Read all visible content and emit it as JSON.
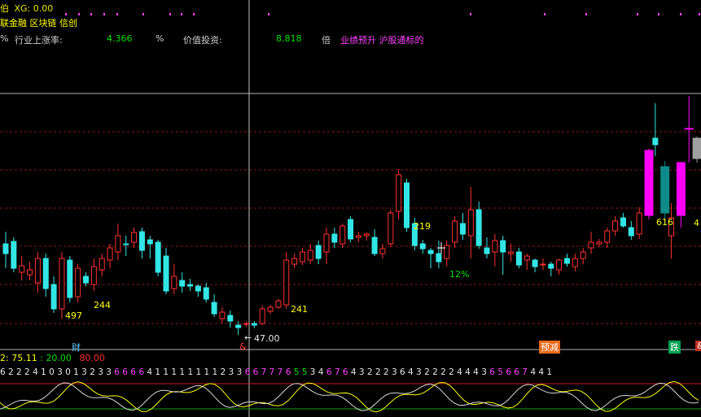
{
  "header": {
    "line1_prefix": "伯",
    "line1_label": "XG: 0.00",
    "line2_text": "联金融 区块链 信创",
    "row3": {
      "c0": "%",
      "c1_label": "行业上涨率:",
      "c1_value": "4.366",
      "c1_unit": "%",
      "c2_label": "价值投资:",
      "c2_value": "8.818",
      "c2_unit": "倍",
      "c3_text": "业绩预升 沪股通标的"
    }
  },
  "colors": {
    "up": "#ff3030",
    "down": "#33e6e6",
    "hot": "#ff00ff",
    "gray_candle": "#a0a0a0",
    "teal_candle": "#0f8a8a",
    "grid": "#8a1818",
    "label_yellow": "#ffff00",
    "label_green": "#00e000",
    "dot": "#ff44ff"
  },
  "price_labels": {
    "l497": "497",
    "l244": "244",
    "l241": "241",
    "l219": "219",
    "pct12": "12%",
    "l616": "616",
    "l4": "4",
    "low": "47.00",
    "low_arrow": "←"
  },
  "event_tags": {
    "cai": "财",
    "huo": "&",
    "yujian": "预减",
    "die": "跌",
    "edge": "&"
  },
  "indicator": {
    "prefix": "2:",
    "v1": "75.11",
    "sep": ":",
    "v2": "20.00",
    "v3": "80.00"
  },
  "kdj_digits": {
    "text_white_a": "6 2 2 2 4 1 0 3 0 1 3 2 3 3",
    "text_mag_a": "6 6 6 6",
    "text_white_b": "4 1 1 1 1 1 1 1",
    "text_white_c": "1 2 3 3",
    "text_mag_b": "6 6 7 7 7 6",
    "text_green_a": "5 5",
    "text_white_d": "3 4",
    "text_mag_c": "6 7 6",
    "text_white_e": "4 3 2 2 2 3",
    "text_white_f": "6 4 3 2 2 2 2 4 4 4 3",
    "text_mag_d": "6 5 6 6 7",
    "text_white_g": "4 4 1"
  },
  "chart_data": {
    "type": "candlestick",
    "series": [
      {
        "o": 300,
        "h": 285,
        "l": 330,
        "c": 312
      },
      {
        "o": 297,
        "h": 292,
        "l": 335,
        "c": 330,
        "dir": "down"
      },
      {
        "o": 335,
        "h": 315,
        "l": 345,
        "c": 327
      },
      {
        "o": 338,
        "h": 322,
        "l": 345,
        "c": 332
      },
      {
        "o": 348,
        "h": 310,
        "l": 360,
        "c": 318
      },
      {
        "o": 318,
        "h": 312,
        "l": 365,
        "c": 355,
        "dir": "down"
      },
      {
        "o": 350,
        "h": 340,
        "l": 385,
        "c": 380,
        "dir": "down"
      },
      {
        "o": 380,
        "h": 310,
        "l": 392,
        "c": 318
      },
      {
        "o": 320,
        "h": 315,
        "l": 372,
        "c": 366,
        "dir": "down"
      },
      {
        "o": 365,
        "h": 325,
        "l": 372,
        "c": 330
      },
      {
        "o": 340,
        "h": 335,
        "l": 352,
        "c": 348,
        "dir": "down"
      },
      {
        "o": 350,
        "h": 318,
        "l": 358,
        "c": 328
      },
      {
        "o": 332,
        "h": 312,
        "l": 340,
        "c": 318
      },
      {
        "o": 320,
        "h": 300,
        "l": 330,
        "c": 305
      },
      {
        "o": 310,
        "h": 275,
        "l": 320,
        "c": 290
      },
      {
        "o": 300,
        "h": 290,
        "l": 315,
        "c": 300
      },
      {
        "o": 298,
        "h": 280,
        "l": 305,
        "c": 286
      },
      {
        "o": 285,
        "h": 280,
        "l": 318,
        "c": 308,
        "dir": "down"
      },
      {
        "o": 295,
        "h": 290,
        "l": 318,
        "c": 300,
        "dir": "down"
      },
      {
        "o": 298,
        "h": 295,
        "l": 340,
        "c": 335,
        "dir": "down"
      },
      {
        "o": 315,
        "h": 305,
        "l": 362,
        "c": 358,
        "dir": "down"
      },
      {
        "o": 355,
        "h": 325,
        "l": 362,
        "c": 340
      },
      {
        "o": 345,
        "h": 335,
        "l": 360,
        "c": 352,
        "dir": "down"
      },
      {
        "o": 350,
        "h": 343,
        "l": 358,
        "c": 352
      },
      {
        "o": 352,
        "h": 350,
        "l": 365,
        "c": 358,
        "dir": "down"
      },
      {
        "o": 354,
        "h": 348,
        "l": 372,
        "c": 368,
        "dir": "down"
      },
      {
        "o": 372,
        "h": 362,
        "l": 390,
        "c": 386,
        "dir": "down"
      },
      {
        "o": 392,
        "h": 378,
        "l": 398,
        "c": 384
      },
      {
        "o": 388,
        "h": 382,
        "l": 403,
        "c": 395
      },
      {
        "o": 400,
        "h": 395,
        "l": 412,
        "c": 403
      },
      {
        "o": 399,
        "h": 396,
        "l": 402,
        "c": 398
      },
      {
        "o": 398,
        "h": 395,
        "l": 404,
        "c": 400
      },
      {
        "o": 398,
        "h": 376,
        "l": 400,
        "c": 380
      },
      {
        "o": 383,
        "h": 375,
        "l": 386,
        "c": 378
      },
      {
        "o": 378,
        "h": 368,
        "l": 380,
        "c": 370
      },
      {
        "o": 375,
        "h": 310,
        "l": 380,
        "c": 320
      },
      {
        "o": 325,
        "h": 312,
        "l": 330,
        "c": 318
      },
      {
        "o": 322,
        "h": 305,
        "l": 326,
        "c": 310
      },
      {
        "o": 320,
        "h": 300,
        "l": 325,
        "c": 308
      },
      {
        "o": 302,
        "h": 296,
        "l": 325,
        "c": 318,
        "dir": "down"
      },
      {
        "o": 310,
        "h": 280,
        "l": 325,
        "c": 288
      },
      {
        "o": 288,
        "h": 280,
        "l": 305,
        "c": 298,
        "dir": "down"
      },
      {
        "o": 300,
        "h": 275,
        "l": 305,
        "c": 278
      },
      {
        "o": 270,
        "h": 266,
        "l": 298,
        "c": 294,
        "dir": "down"
      },
      {
        "o": 292,
        "h": 285,
        "l": 298,
        "c": 290
      },
      {
        "o": 290,
        "h": 286,
        "l": 296,
        "c": 288
      },
      {
        "o": 292,
        "h": 282,
        "l": 315,
        "c": 312,
        "dir": "down"
      },
      {
        "o": 312,
        "h": 300,
        "l": 318,
        "c": 306
      },
      {
        "o": 300,
        "h": 258,
        "l": 304,
        "c": 262
      },
      {
        "o": 260,
        "h": 208,
        "l": 270,
        "c": 215
      },
      {
        "o": 225,
        "h": 220,
        "l": 285,
        "c": 280,
        "dir": "down"
      },
      {
        "o": 275,
        "h": 268,
        "l": 308,
        "c": 302,
        "dir": "down"
      },
      {
        "o": 300,
        "h": 295,
        "l": 312,
        "c": 306
      },
      {
        "o": 308,
        "h": 305,
        "l": 330,
        "c": 312,
        "dir": "down"
      },
      {
        "o": 312,
        "h": 296,
        "l": 330,
        "c": 322
      },
      {
        "o": 318,
        "h": 296,
        "l": 328,
        "c": 302
      },
      {
        "o": 298,
        "h": 266,
        "l": 305,
        "c": 272
      },
      {
        "o": 275,
        "h": 262,
        "l": 295,
        "c": 288
      },
      {
        "o": 290,
        "h": 230,
        "l": 318,
        "c": 258
      },
      {
        "o": 258,
        "h": 248,
        "l": 306,
        "c": 302,
        "dir": "down"
      },
      {
        "o": 305,
        "h": 292,
        "l": 318,
        "c": 312,
        "dir": "down"
      },
      {
        "o": 310,
        "h": 288,
        "l": 328,
        "c": 296
      },
      {
        "o": 296,
        "h": 290,
        "l": 338,
        "c": 310,
        "dir": "down"
      },
      {
        "o": 312,
        "h": 300,
        "l": 322,
        "c": 310
      },
      {
        "o": 310,
        "h": 305,
        "l": 330,
        "c": 326,
        "dir": "down"
      },
      {
        "o": 320,
        "h": 312,
        "l": 332,
        "c": 315
      },
      {
        "o": 320,
        "h": 318,
        "l": 335,
        "c": 328,
        "dir": "down"
      },
      {
        "o": 326,
        "h": 318,
        "l": 332,
        "c": 325
      },
      {
        "o": 325,
        "h": 322,
        "l": 340,
        "c": 330,
        "dir": "down"
      },
      {
        "o": 332,
        "h": 318,
        "l": 338,
        "c": 320
      },
      {
        "o": 318,
        "h": 312,
        "l": 328,
        "c": 324,
        "dir": "down"
      },
      {
        "o": 328,
        "h": 312,
        "l": 334,
        "c": 318
      },
      {
        "o": 318,
        "h": 305,
        "l": 325,
        "c": 310
      },
      {
        "o": 305,
        "h": 285,
        "l": 312,
        "c": 298
      },
      {
        "o": 300,
        "h": 294,
        "l": 304,
        "c": 298
      },
      {
        "o": 298,
        "h": 280,
        "l": 305,
        "c": 284
      },
      {
        "o": 284,
        "h": 266,
        "l": 290,
        "c": 272
      },
      {
        "o": 268,
        "h": 262,
        "l": 280,
        "c": 278,
        "dir": "down"
      },
      {
        "o": 280,
        "h": 272,
        "l": 295,
        "c": 290,
        "dir": "down"
      },
      {
        "o": 288,
        "h": 255,
        "l": 294,
        "c": 262
      },
      {
        "o": 265,
        "h": 183,
        "l": 270,
        "c": 185,
        "dir": "hot"
      },
      {
        "o": 178,
        "h": 127,
        "l": 192,
        "c": 170,
        "dir": "down"
      },
      {
        "o": 205,
        "h": 198,
        "l": 270,
        "c": 262,
        "dir": "teal"
      },
      {
        "o": 290,
        "h": 250,
        "l": 318,
        "c": 268
      },
      {
        "o": 265,
        "h": 200,
        "l": 280,
        "c": 200,
        "dir": "hot"
      },
      {
        "o": 158,
        "h": 118,
        "l": 200,
        "c": 158,
        "dir": "hot"
      },
      {
        "o": 170,
        "h": 168,
        "l": 200,
        "c": 195,
        "dir": "gray"
      }
    ]
  }
}
